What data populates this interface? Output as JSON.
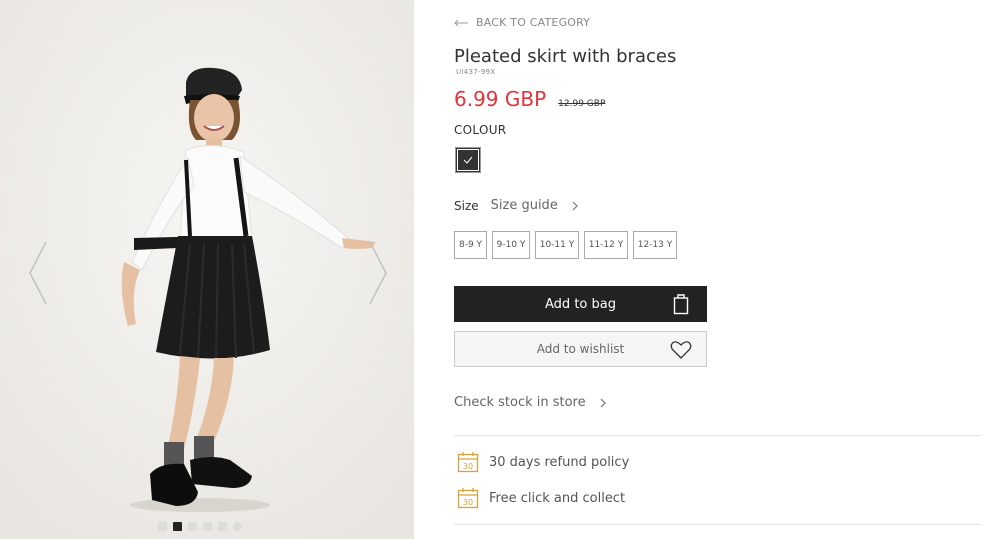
{
  "gallery": {
    "image_alt": "Girl wearing white shirt, black pleated skirt with braces, cap and patent shoes",
    "slide_count": 6,
    "active_slide": 2,
    "prev_icon": "chevron-left-icon",
    "next_icon": "chevron-right-icon"
  },
  "product": {
    "back_label": "BACK TO CATEGORY",
    "title": "Pleated skirt with braces",
    "sku": "UI437-99X",
    "price": "6.99 GBP",
    "old_price": "12.99 GBP",
    "colour_label": "COLOUR",
    "colour_selected": "#333333",
    "size_label": "Size",
    "size_guide_label": "Size guide",
    "sizes": [
      "8-9 Y",
      "9-10 Y",
      "10-11 Y",
      "11-12 Y",
      "12-13 Y"
    ],
    "add_to_bag_label": "Add to bag",
    "add_to_wishlist_label": "Add to wishlist",
    "check_stock_label": "Check stock in store",
    "perks": [
      {
        "icon": "calendar-30-icon",
        "day": "30",
        "label": "30 days refund policy"
      },
      {
        "icon": "calendar-30-icon",
        "day": "30",
        "label": "Free click and collect"
      }
    ]
  },
  "colors": {
    "price_red": "#e3333b",
    "button_dark": "#222222",
    "perk_icon": "#d9a13b"
  }
}
